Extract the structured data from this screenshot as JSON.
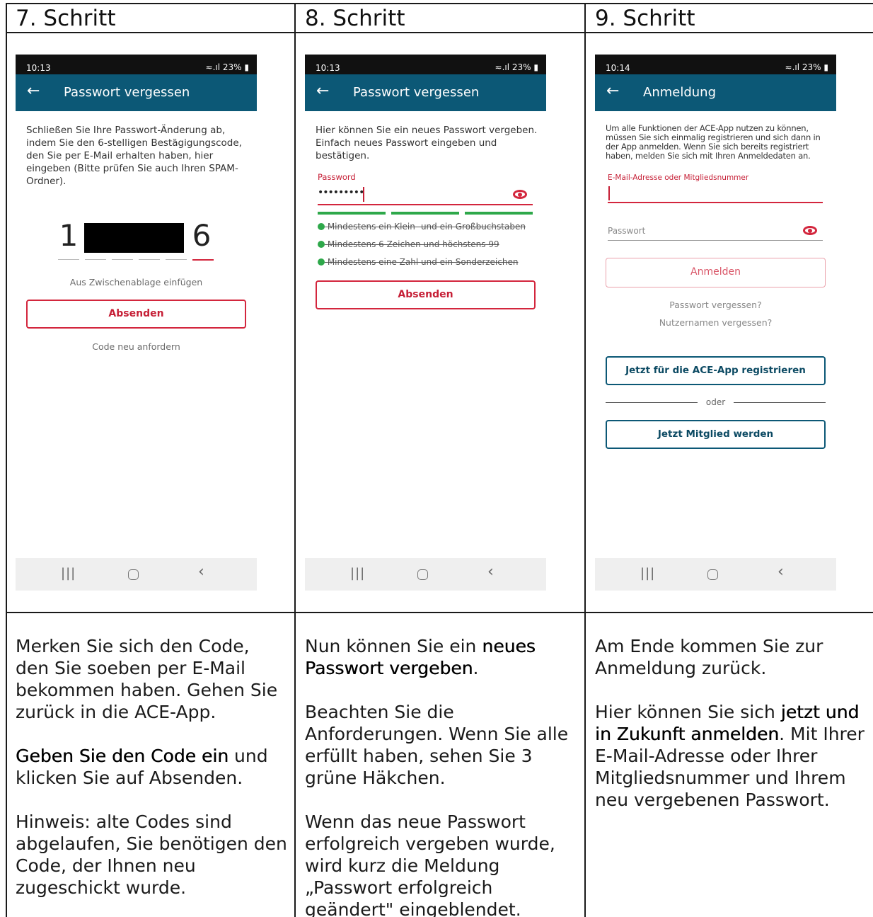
{
  "headers": [
    "7. Schritt",
    "8. Schritt",
    "9. Schritt"
  ],
  "phone1": {
    "status_time": "10:13",
    "status_right": "23%",
    "appbar_title": "Passwort vergessen",
    "intro": "Schließen Sie Ihre Passwort-Änderung ab, indem Sie den 6-stelligen Bestägigungscode, den Sie per E-Mail erhalten haben, hier eingeben (Bitte prüfen Sie auch Ihren SPAM-Ordner).",
    "code_first": "1",
    "code_last": "6",
    "paste_link": "Aus Zwischenablage einfügen",
    "submit": "Absenden",
    "resend_link": "Code neu anfordern"
  },
  "phone2": {
    "status_time": "10:13",
    "status_right": "23%",
    "appbar_title": "Passwort vergessen",
    "intro": "Hier können Sie ein neues Passwort vergeben. Einfach neues Passwort eingeben und bestätigen.",
    "password_label": "Password",
    "password_value": "•••••••••",
    "rules": [
      "Mindestens ein Klein- und ein Großbuchstaben",
      "Mindestens 6 Zeichen und höchstens 99",
      "Mindestens eine Zahl und ein Sonderzeichen"
    ],
    "submit": "Absenden",
    "colors": {
      "accent_red": "#d3263d",
      "success_green": "#2ea84a"
    }
  },
  "phone3": {
    "status_time": "10:14",
    "status_right": "23%",
    "appbar_title": "Anmeldung",
    "intro": "Um alle Funktionen der ACE-App nutzen zu können, müssen Sie sich einmalig registrieren und sich dann in der App anmelden. Wenn Sie sich bereits registriert haben, melden Sie sich mit Ihren Anmeldedaten an.",
    "email_label": "E-Mail-Adresse oder Mitgliedsnummer",
    "password_placeholder": "Passwort",
    "login": "Anmelden",
    "forgot_password": "Passwort vergessen?",
    "forgot_username": "Nutzernamen vergessen?",
    "register": "Jetzt für die ACE-App registrieren",
    "or": "oder",
    "become_member": "Jetzt Mitglied werden",
    "colors": {
      "appbar": "#0c5876"
    }
  },
  "captions": {
    "col1": {
      "p1": "Merken Sie sich den Code, den Sie soeben per E-Mail bekommen haben. Gehen Sie zurück in die ACE-App.",
      "p2_bold": "Geben Sie den Code ein",
      "p2_rest": " und klicken Sie auf Absenden.",
      "p3": "Hinweis: alte Codes sind abgelaufen, Sie benötigen den Code, der Ihnen neu zugeschickt wurde."
    },
    "col2": {
      "p1_pre": "Nun können Sie ein ",
      "p1_bold": "neues Passwort vergeben",
      "p1_post": ".",
      "p2": "Beachten Sie die Anforderungen. Wenn Sie alle erfüllt haben, sehen Sie 3 grüne Häkchen.",
      "p3": "Wenn das neue Passwort erfolgreich vergeben wurde, wird kurz die Meldung „Passwort erfolgreich geändert\" eingeblendet."
    },
    "col3": {
      "p1": "Am Ende kommen Sie zur Anmeldung zurück.",
      "p2_pre": "Hier können Sie sich ",
      "p2_bold": "jetzt und in Zukunft anmelden",
      "p2_post": ". Mit Ihrer E-Mail-Adresse oder Ihrer Mitgliedsnummer und Ihrem neu vergebenen Passwort."
    }
  }
}
